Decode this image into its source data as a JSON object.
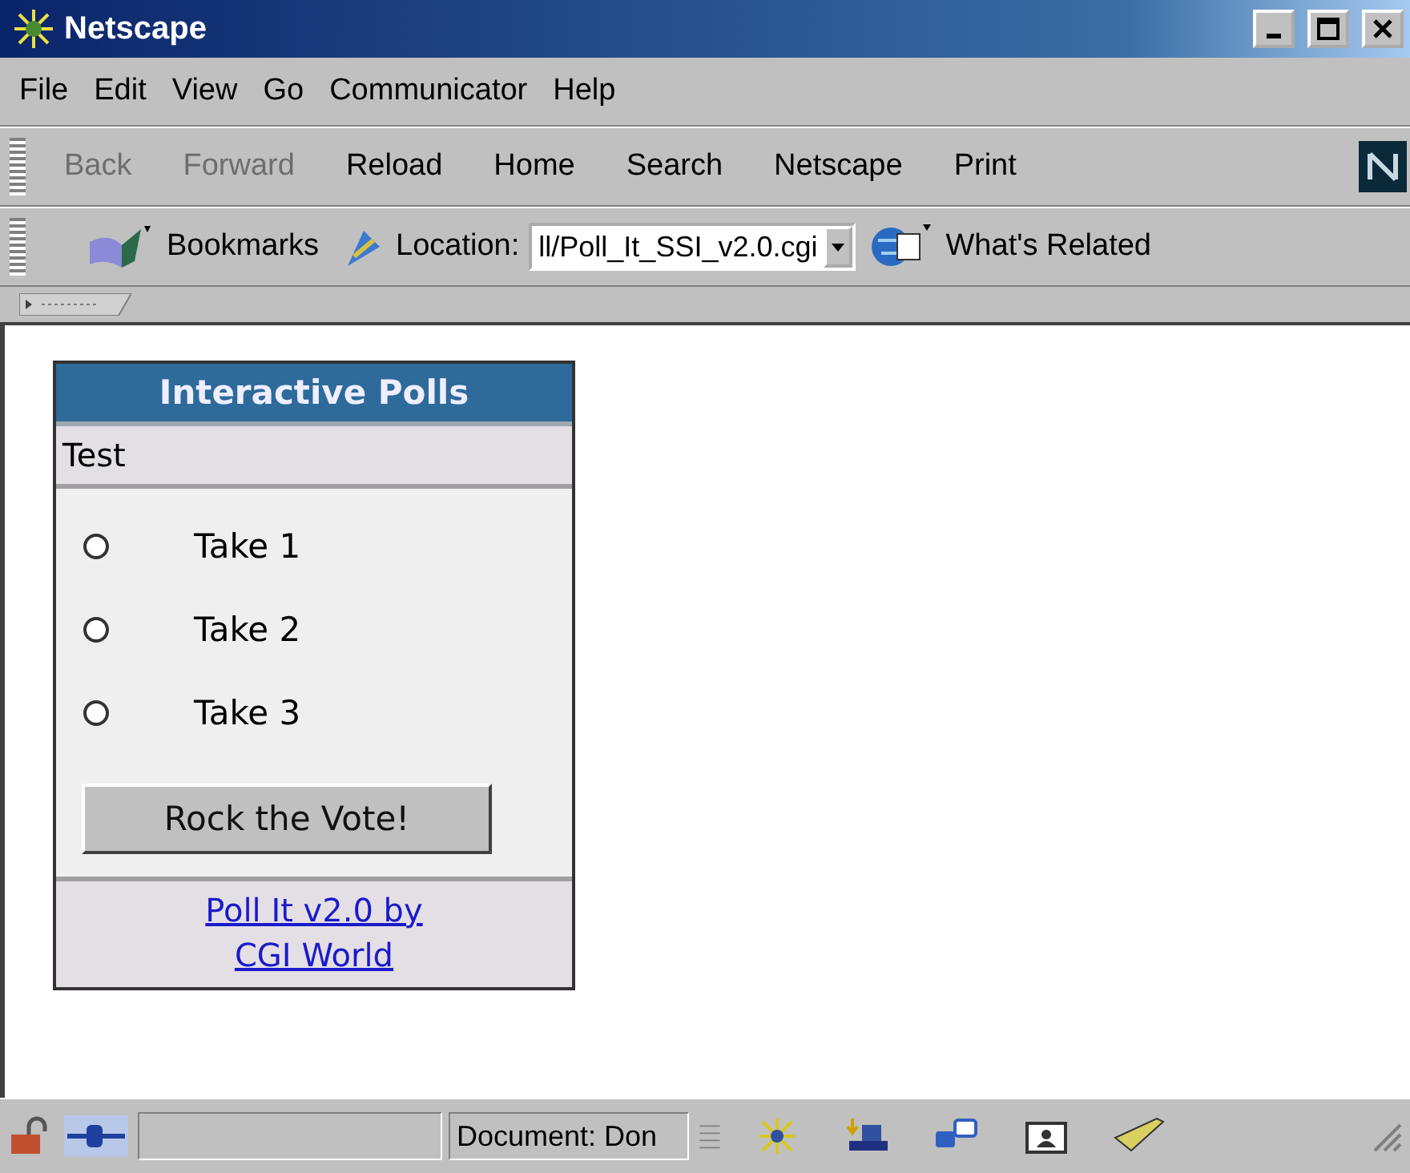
{
  "window": {
    "title": "Netscape"
  },
  "menu": [
    "File",
    "Edit",
    "View",
    "Go",
    "Communicator",
    "Help"
  ],
  "navigation_toolbar": [
    {
      "label": "Back",
      "disabled": true
    },
    {
      "label": "Forward",
      "disabled": true
    },
    {
      "label": "Reload",
      "disabled": false
    },
    {
      "label": "Home",
      "disabled": false
    },
    {
      "label": "Search",
      "disabled": false
    },
    {
      "label": "Netscape",
      "disabled": false
    },
    {
      "label": "Print",
      "disabled": false
    }
  ],
  "location_toolbar": {
    "bookmarks": "Bookmarks",
    "location_label": "Location:",
    "location_value": "ll/Poll_It_SSI_v2.0.cgi",
    "whats_related": "What's Related"
  },
  "poll": {
    "title": "Interactive Polls",
    "question": "Test",
    "options": [
      {
        "label": "Take 1",
        "selected": false
      },
      {
        "label": "Take 2",
        "selected": false
      },
      {
        "label": "Take 3",
        "selected": false
      }
    ],
    "button": "Rock the Vote!",
    "credit_link": "Poll It v2.0 by CGI World"
  },
  "status_bar": {
    "text": "Document: Don"
  }
}
